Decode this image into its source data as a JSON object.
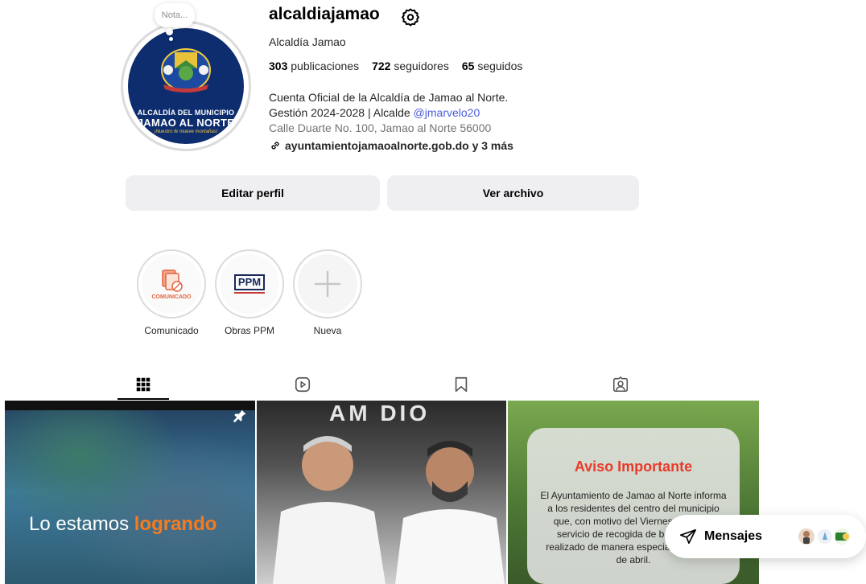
{
  "profile": {
    "username": "alcaldiajamao",
    "full_name": "Alcaldía Jamao",
    "note": "Nota...",
    "avatar_text": {
      "line1": "ALCALDÍA DEL MUNICIPIO",
      "line2": "JAMAO AL NORTE",
      "line3": "¡Nuestro fe mueve montañas!"
    },
    "stats": {
      "posts_count": "303",
      "posts_label": "publicaciones",
      "followers_count": "722",
      "followers_label": "seguidores",
      "following_count": "65",
      "following_label": "seguidos"
    },
    "bio_line1": "Cuenta Oficial de la Alcaldía de Jamao al Norte.",
    "bio_line2_prefix": "Gestión 2024-2028 | Alcalde ",
    "bio_mention": "@jmarvelo20",
    "address": "Calle Duarte No. 100, Jamao al Norte 56000",
    "link": "ayuntamientojamaoalnorte.gob.do y 3 más"
  },
  "buttons": {
    "edit": "Editar perfil",
    "archive": "Ver archivo"
  },
  "highlights": [
    {
      "label": "Comunicado",
      "badge": "COMUNICADO"
    },
    {
      "label": "Obras PPM",
      "badge": "PPM"
    },
    {
      "label": "Nueva"
    }
  ],
  "tabs": {
    "active": "posts",
    "items": [
      "posts-grid",
      "reels",
      "saved",
      "tagged"
    ]
  },
  "posts": [
    {
      "headline_prefix": "Lo estamos ",
      "headline_accent": "logrando",
      "pinned": true
    },
    {
      "banner": "AM    DIO"
    },
    {
      "title": "Aviso Importante",
      "text": "El Ayuntamiento de Jamao al Norte informa a los residentes del centro del municipio que, con motivo del Viernes Santo, el servicio de recogida de basura será realizado de manera especial el jueves 2 de abril."
    }
  ],
  "messages": {
    "label": "Mensajes"
  },
  "colors": {
    "accent_link": "#4a5dd9",
    "button_bg": "#efeff1",
    "post_accent": "#f47c20",
    "aviso_red": "#e83a2a"
  }
}
